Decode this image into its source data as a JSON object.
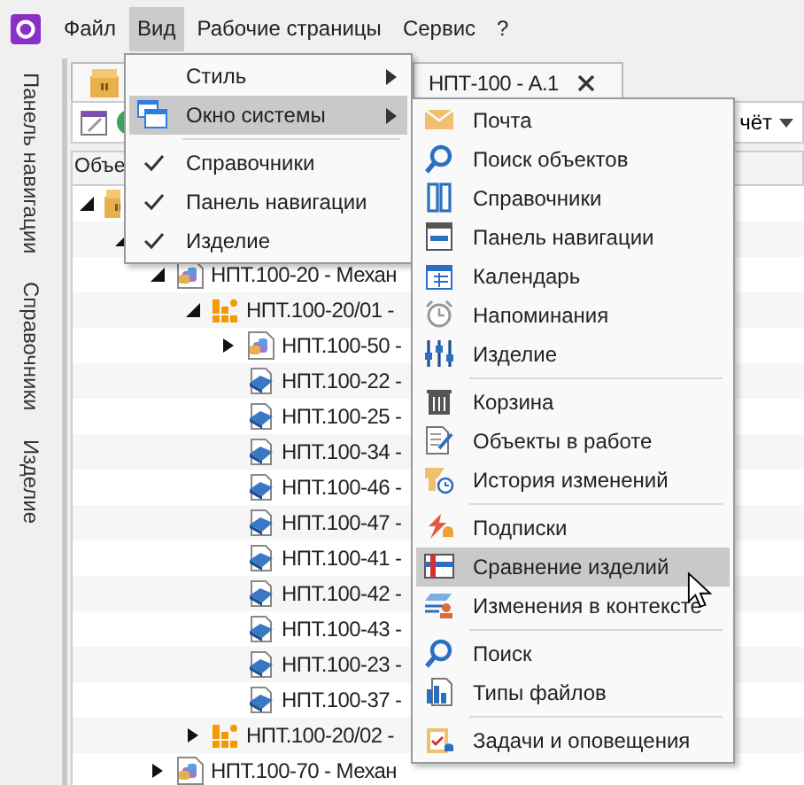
{
  "menubar": {
    "items": [
      {
        "label": "Файл",
        "selected": false
      },
      {
        "label": "Вид",
        "selected": true
      },
      {
        "label": "Рабочие страницы",
        "selected": false
      },
      {
        "label": "Сервис",
        "selected": false
      },
      {
        "label": "?",
        "selected": false
      }
    ]
  },
  "sidebar": {
    "tabs": [
      {
        "label": "Панель навигации"
      },
      {
        "label": "Справочники"
      },
      {
        "label": "Изделие"
      }
    ]
  },
  "document_tabs": [
    {
      "kind": "product"
    },
    {
      "kind": "document",
      "label": "НПТ-100 - А.1"
    }
  ],
  "toolbar": {
    "report_button": "чёт"
  },
  "tree": {
    "column_header": "Объе",
    "rows": [
      {
        "kind": "product",
        "expanded": true,
        "children": [
          {
            "expanded": true,
            "children": [
              {
                "kind": "assembly",
                "label": "НПТ.100-20 - Механ",
                "expanded": true,
                "children": [
                  {
                    "kind": "group",
                    "label": "НПТ.100-20/01 -",
                    "expanded": true,
                    "children": [
                      {
                        "kind": "assembly",
                        "label": "НПТ.100-50 -",
                        "expanded": false
                      },
                      {
                        "kind": "part",
                        "label": "НПТ.100-22 -"
                      },
                      {
                        "kind": "part",
                        "label": "НПТ.100-25 -"
                      },
                      {
                        "kind": "part",
                        "label": "НПТ.100-34 -"
                      },
                      {
                        "kind": "part",
                        "label": "НПТ.100-46 -"
                      },
                      {
                        "kind": "part",
                        "label": "НПТ.100-47 -"
                      },
                      {
                        "kind": "part",
                        "label": "НПТ.100-41 -"
                      },
                      {
                        "kind": "part",
                        "label": "НПТ.100-42 -"
                      },
                      {
                        "kind": "part",
                        "label": "НПТ.100-43 -"
                      },
                      {
                        "kind": "part",
                        "label": "НПТ.100-23 -"
                      },
                      {
                        "kind": "part",
                        "label": "НПТ.100-37 -"
                      }
                    ]
                  },
                  {
                    "kind": "group",
                    "label": "НПТ.100-20/02 -",
                    "expanded": false
                  }
                ]
              },
              {
                "kind": "assembly",
                "label": "НПТ.100-70 - Механ",
                "expanded": false
              }
            ]
          }
        ]
      }
    ]
  },
  "view_menu": {
    "items": [
      {
        "kind": "submenu",
        "label": "Стиль",
        "selected": false,
        "separator_before": false
      },
      {
        "kind": "submenu",
        "label": "Окно системы",
        "selected": true,
        "separator_before": false
      },
      {
        "kind": "check",
        "label": "Справочники",
        "checked": true,
        "selected": false,
        "separator_before": true
      },
      {
        "kind": "check",
        "label": "Панель навигации",
        "checked": true,
        "selected": false,
        "separator_before": false
      },
      {
        "kind": "check",
        "label": "Изделие",
        "checked": true,
        "selected": false,
        "separator_before": false
      }
    ]
  },
  "window_submenu": {
    "items": [
      {
        "label": "Почта",
        "selected": false,
        "separator_before": false
      },
      {
        "label": "Поиск объектов",
        "selected": false,
        "separator_before": false
      },
      {
        "label": "Справочники",
        "selected": false,
        "separator_before": false
      },
      {
        "label": "Панель навигации",
        "selected": false,
        "separator_before": false
      },
      {
        "label": "Календарь",
        "selected": false,
        "separator_before": false
      },
      {
        "label": "Напоминания",
        "selected": false,
        "separator_before": false
      },
      {
        "label": "Изделие",
        "selected": false,
        "separator_before": false
      },
      {
        "label": "Корзина",
        "selected": false,
        "separator_before": true
      },
      {
        "label": "Объекты в работе",
        "selected": false,
        "separator_before": false
      },
      {
        "label": "История изменений",
        "selected": false,
        "separator_before": false
      },
      {
        "label": "Подписки",
        "selected": false,
        "separator_before": true
      },
      {
        "label": "Сравнение изделий",
        "selected": true,
        "separator_before": false
      },
      {
        "label": "Изменения в контексте",
        "selected": false,
        "separator_before": false
      },
      {
        "label": "Поиск",
        "selected": false,
        "separator_before": true
      },
      {
        "label": "Типы файлов",
        "selected": false,
        "separator_before": false
      },
      {
        "label": "Задачи и оповещения",
        "selected": false,
        "separator_before": true
      }
    ]
  }
}
